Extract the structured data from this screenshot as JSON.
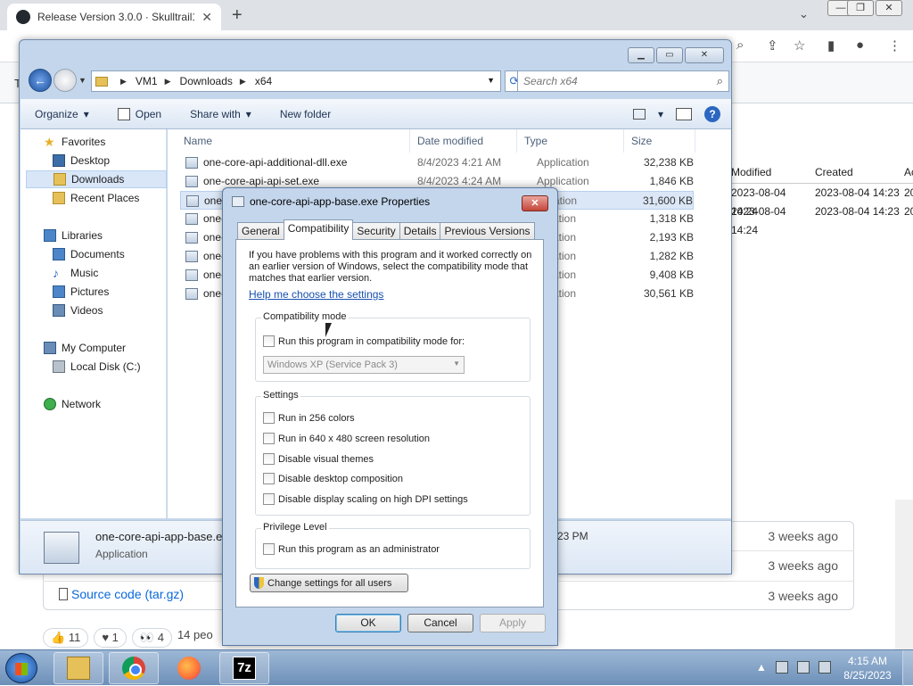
{
  "browser": {
    "tab_title": "Release Version 3.0.0 · Skulltrail1İ",
    "window_controls": [
      "—",
      "❐",
      "✕"
    ]
  },
  "github": {
    "assets_table": {
      "headers": [
        "Modified",
        "Created",
        "Ac"
      ],
      "rows": [
        [
          "2023-08-04 14:24",
          "2023-08-04 14:23",
          "20"
        ],
        [
          "2023-08-04 14:24",
          "2023-08-04 14:23",
          "20"
        ]
      ]
    },
    "asset_source": "Source code (tar.gz)",
    "asset_ago": [
      "3 weeks ago",
      "3 weeks ago",
      "3 weeks ago"
    ],
    "reactions": [
      "11",
      "1",
      "4"
    ],
    "people_text": "14 peo"
  },
  "explorer": {
    "breadcrumb": [
      "VM1",
      "Downloads",
      "x64"
    ],
    "search_placeholder": "Search x64",
    "commands": {
      "organize": "Organize",
      "open": "Open",
      "share_with": "Share with",
      "new_folder": "New folder"
    },
    "nav": {
      "favorites": "Favorites",
      "desktop": "Desktop",
      "downloads": "Downloads",
      "recent_places": "Recent Places",
      "libraries": "Libraries",
      "documents": "Documents",
      "music": "Music",
      "pictures": "Pictures",
      "videos": "Videos",
      "my_computer": "My Computer",
      "local_disk": "Local Disk (C:)",
      "network": "Network"
    },
    "columns": [
      "Name",
      "Date modified",
      "Type",
      "Size"
    ],
    "files": [
      {
        "name": "one-core-api-additional-dll.exe",
        "date": "8/4/2023 4:21 AM",
        "type": "Application",
        "size": "32,238 KB"
      },
      {
        "name": "one-core-api-api-set.exe",
        "date": "8/4/2023 4:24 AM",
        "type": "Application",
        "size": "1,846 KB"
      },
      {
        "name": "one-",
        "date": "",
        "type": "plication",
        "size": "31,600 KB"
      },
      {
        "name": "one-",
        "date": "",
        "type": "plication",
        "size": "1,318 KB"
      },
      {
        "name": "one-",
        "date": "",
        "type": "plication",
        "size": "2,193 KB"
      },
      {
        "name": "one-",
        "date": "",
        "type": "plication",
        "size": "1,282 KB"
      },
      {
        "name": "one-",
        "date": "",
        "type": "plication",
        "size": "9,408 KB"
      },
      {
        "name": "one-",
        "date": "",
        "type": "plication",
        "size": "30,561 KB"
      }
    ],
    "details": {
      "name": "one-core-api-app-base.e",
      "type": "Application",
      "time": "23 PM"
    }
  },
  "dialog": {
    "title": "one-core-api-app-base.exe Properties",
    "tabs": [
      "General",
      "Compatibility",
      "Security",
      "Details",
      "Previous Versions"
    ],
    "intro": "If you have problems with this program and it worked correctly on an earlier version of Windows, select the compatibility mode that matches that earlier version.",
    "help_link": "Help me choose the settings",
    "compat_group": "Compatibility mode",
    "compat_check": "Run this program in compatibility mode for:",
    "compat_select": "Windows XP (Service Pack 3)",
    "settings_group": "Settings",
    "settings": [
      "Run in 256 colors",
      "Run in 640 x 480 screen resolution",
      "Disable visual themes",
      "Disable desktop composition",
      "Disable display scaling on high DPI settings"
    ],
    "privilege_group": "Privilege Level",
    "privilege_check": "Run this program as an administrator",
    "change_all": "Change settings for all users",
    "ok": "OK",
    "cancel": "Cancel",
    "apply": "Apply"
  },
  "taskbar": {
    "time": "4:15 AM",
    "date": "8/25/2023",
    "seven_zip_label": "7z"
  }
}
